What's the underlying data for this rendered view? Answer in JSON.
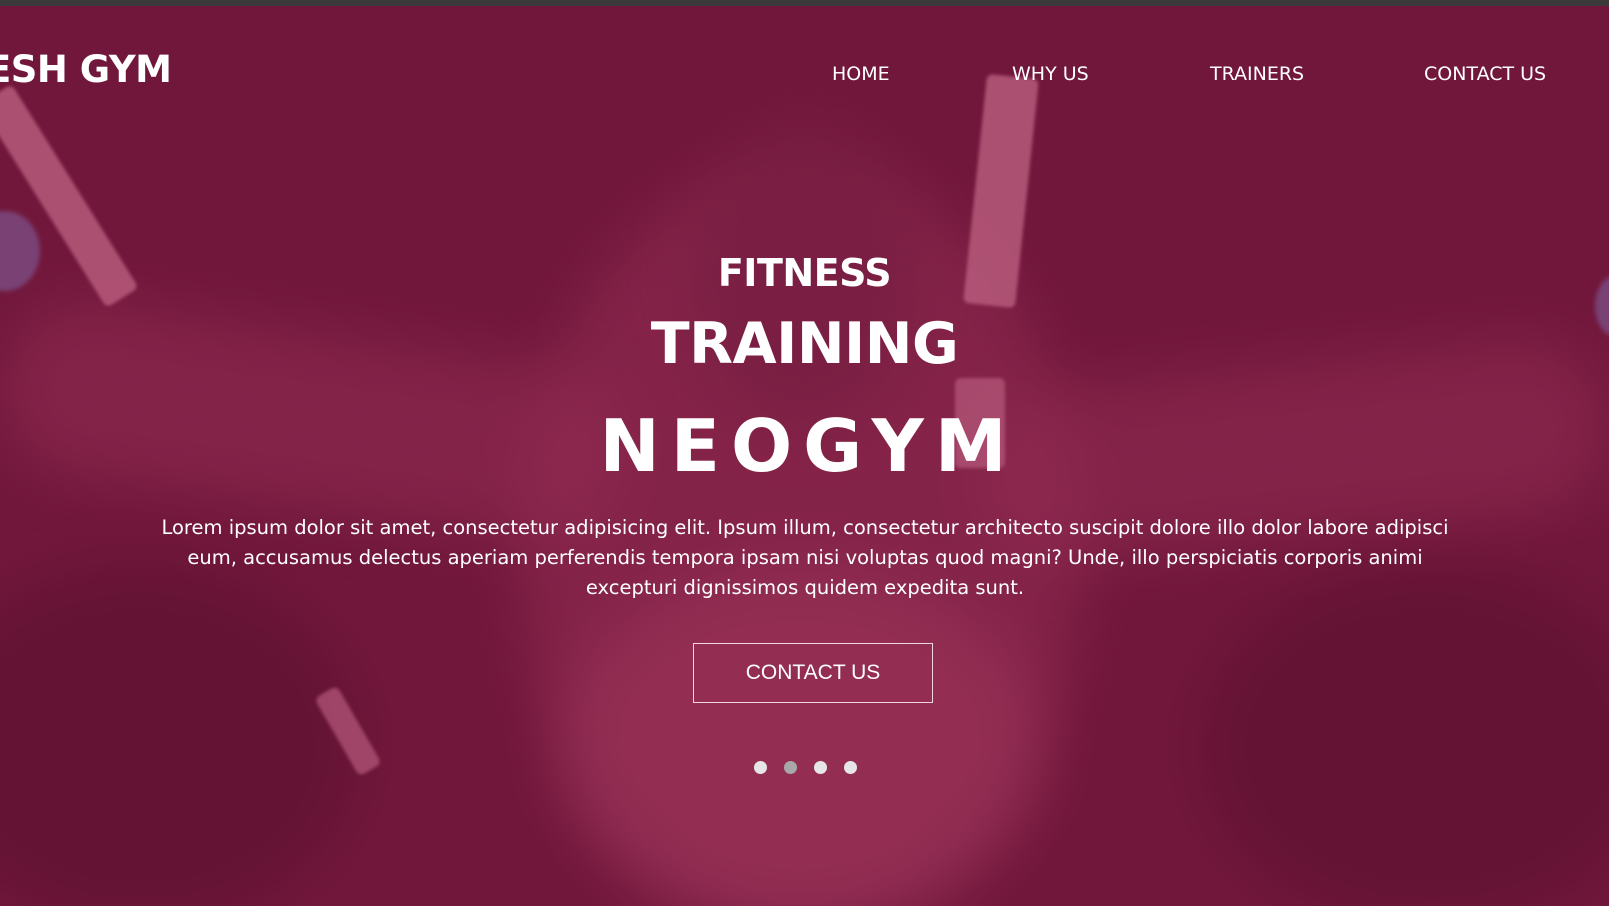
{
  "header": {
    "brand": "ESH GYM",
    "nav": [
      {
        "label": "HOME"
      },
      {
        "label": "WHY US"
      },
      {
        "label": "TRAINERS"
      },
      {
        "label": "CONTACT US"
      }
    ]
  },
  "hero": {
    "kicker": "FITNESS",
    "title": "TRAINING",
    "brand_title": "NEOGYM",
    "description": "Lorem ipsum dolor sit amet, consectetur adipisicing elit. Ipsum illum, consectetur architecto suscipit dolore illo dolor labore adipisci eum, accusamus delectus aperiam perferendis tempora ipsam nisi voluptas quod magni? Unde, illo perspiciatis corporis animi excepturi dignissimos quidem expedita sunt.",
    "cta_label": "CONTACT US",
    "slides": {
      "count": 4,
      "active_index": 1
    }
  },
  "colors": {
    "overlay": "#6e1a3c",
    "text": "#ffffff",
    "dot": "#e6e6e6",
    "dot_active": "#a8a8a8"
  }
}
